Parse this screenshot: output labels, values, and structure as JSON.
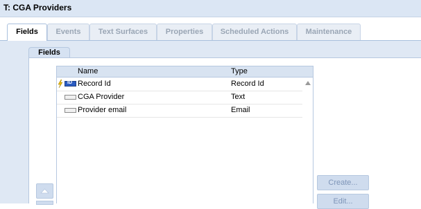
{
  "window": {
    "title": "T: CGA Providers"
  },
  "tabs": [
    {
      "label": "Fields",
      "active": true
    },
    {
      "label": "Events",
      "active": false
    },
    {
      "label": "Text Surfaces",
      "active": false
    },
    {
      "label": "Properties",
      "active": false
    },
    {
      "label": "Scheduled Actions",
      "active": false
    },
    {
      "label": "Maintenance",
      "active": false
    }
  ],
  "panel": {
    "title": "Fields"
  },
  "grid": {
    "columns": [
      "Name",
      "Type"
    ],
    "rows": [
      {
        "name": "Record Id",
        "type": "Record Id",
        "icon": "record-id-icon",
        "key": true
      },
      {
        "name": "CGA Provider",
        "type": "Text",
        "icon": "text-field-icon",
        "key": false
      },
      {
        "name": "Provider email",
        "type": "Email",
        "icon": "text-field-icon",
        "key": false
      }
    ]
  },
  "buttons": {
    "create": "Create...",
    "edit": "Edit..."
  },
  "colors": {
    "accent": "#dbe6f4",
    "panel": "#dfe8f4",
    "button": "#cfdcee"
  }
}
